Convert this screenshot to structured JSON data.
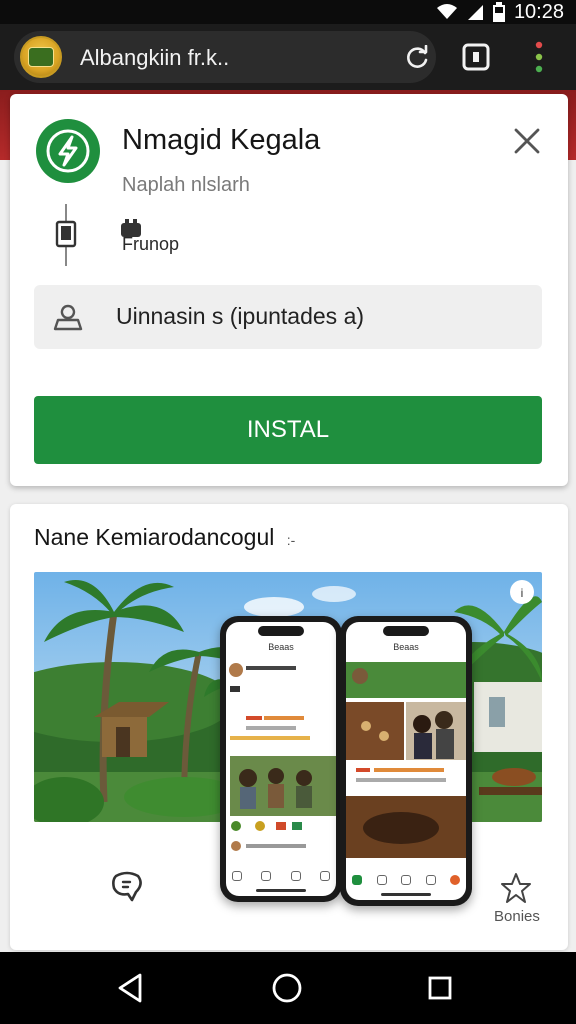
{
  "status_bar": {
    "time": "10:28",
    "icons": [
      "wifi-icon",
      "signal-icon",
      "battery-icon"
    ]
  },
  "browser": {
    "url_text": "Albangkiin fr.k..",
    "icons": [
      "site-logo",
      "reload-icon",
      "tabs-icon",
      "menu-dots-icon"
    ],
    "menu_dot_colors": [
      "#e24b4b",
      "#8bc34a",
      "#4caf50"
    ]
  },
  "install_card": {
    "app_title": "Nmagid Kegala",
    "app_subtitle": "Naplah nlslarh",
    "size_text": "Frunop",
    "info_text": "Uinnasin s (ipuntades a)",
    "install_label": "INSTAL",
    "accent_color": "#1f8f3e"
  },
  "preview": {
    "title": "Nane Kemiarodancogul",
    "title_suffix": ":-",
    "phone_left_header": "Beaas",
    "phone_right_header": "Beaas",
    "star_label": "Bonies"
  },
  "nav_bar": {
    "icons": [
      "back-icon",
      "home-icon",
      "recents-icon"
    ]
  }
}
